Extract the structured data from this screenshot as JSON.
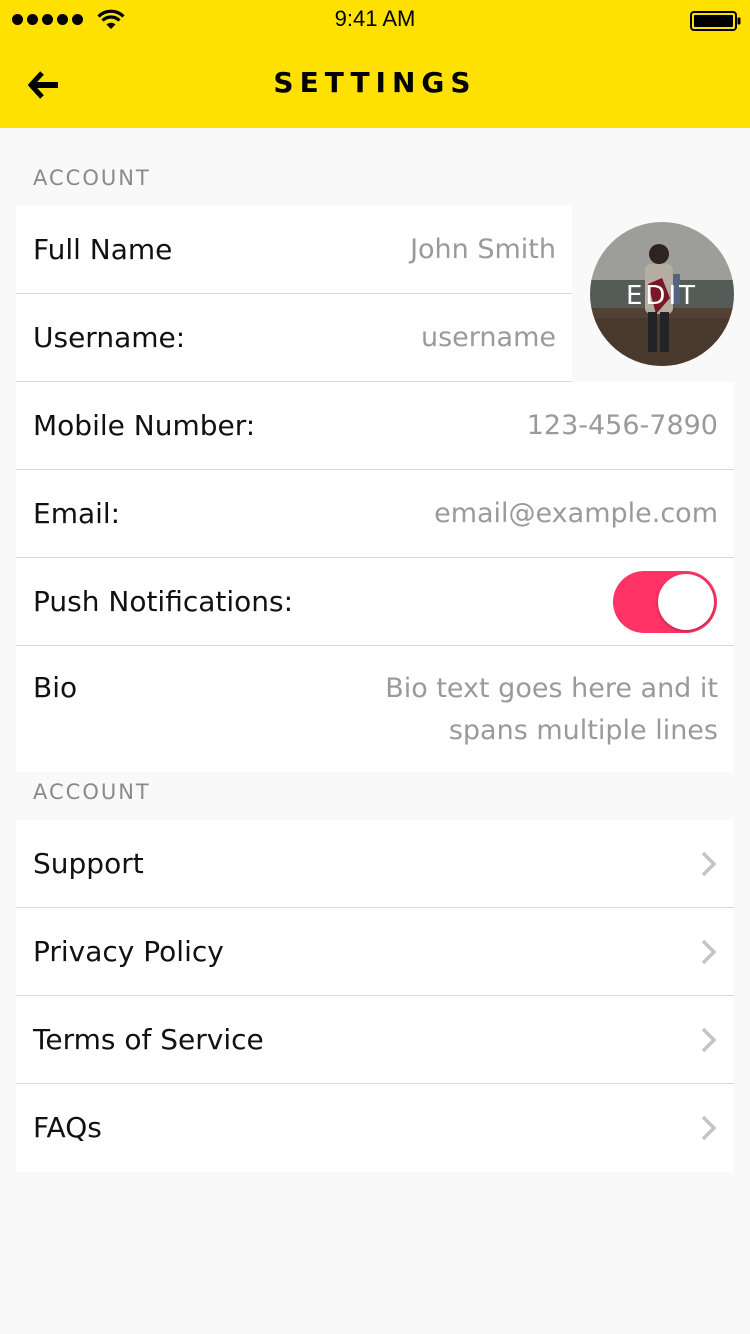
{
  "status_bar": {
    "time": "9:41 AM"
  },
  "header": {
    "title": "SETTINGS",
    "back_icon": "arrow-left-icon",
    "background": "#ffe100"
  },
  "profile_section": {
    "label": "ACCOUNT",
    "avatar_label": "EDIT",
    "fields": [
      {
        "label": "Full Name",
        "value": "John Smith"
      },
      {
        "label": "Username:",
        "value": "username"
      },
      {
        "label": "Mobile Number:",
        "value": "123-456-7890"
      },
      {
        "label": "Email:",
        "value": "email@example.com"
      }
    ],
    "push_notifications": {
      "label": "Push Notifications:",
      "enabled": true,
      "color": "#ff3366"
    },
    "bio": {
      "label": "Bio",
      "value_line1": "Bio text goes here and it",
      "value_line2": "spans multiple lines"
    }
  },
  "links_section": {
    "label": "ACCOUNT",
    "items": [
      {
        "label": "Support"
      },
      {
        "label": "Privacy Policy"
      },
      {
        "label": "Terms of Service"
      },
      {
        "label": "FAQs"
      }
    ]
  }
}
